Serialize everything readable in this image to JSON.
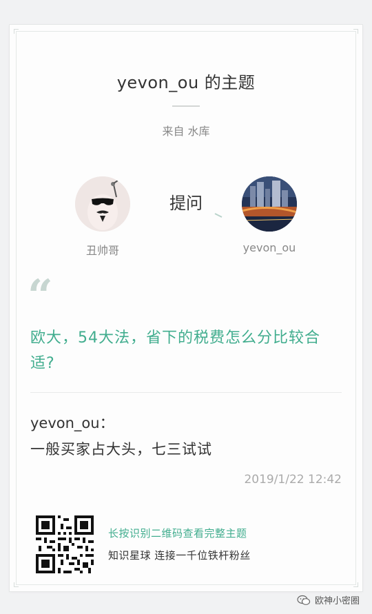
{
  "header": {
    "title": "yevon_ou 的主题",
    "source": "来自 水库"
  },
  "ask": {
    "label": "提问",
    "from_name": "丑帅哥",
    "to_name": "yevon_ou"
  },
  "question": {
    "text": "欧大，54大法，省下的税费怎么分比较合适?"
  },
  "answer": {
    "author": "yevon_ou：",
    "text": "一般买家占大头，七三试试",
    "timestamp": "2019/1/22 12:42"
  },
  "footer": {
    "qr_cta": "长按识别二维码查看完整主题",
    "qr_desc": "知识星球 连接一千位铁杆粉丝"
  },
  "watermark": {
    "text": "欧神小密圈",
    "icon": "wechat-icon"
  },
  "colors": {
    "accent": "#41ad8e",
    "text": "#333333",
    "muted": "#888888",
    "quote": "#c7d6d1"
  }
}
